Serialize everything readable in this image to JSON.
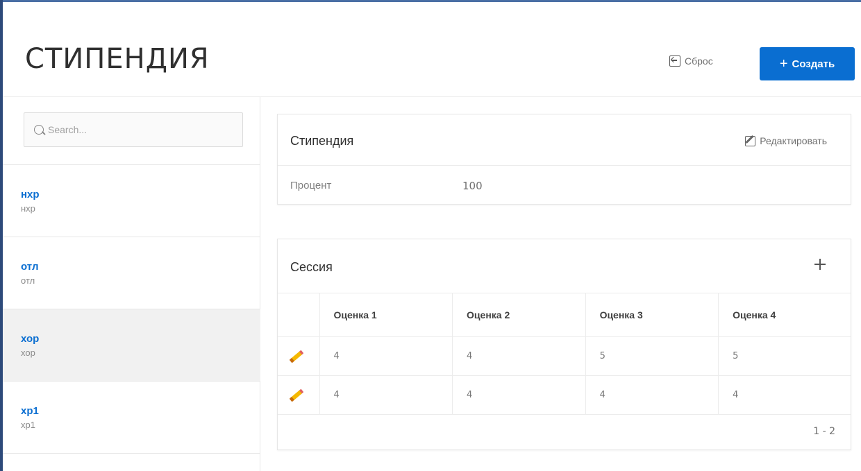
{
  "header": {
    "title": "СТИПЕНДИЯ",
    "reset_label": "Сброс",
    "create_label": "Создать"
  },
  "sidebar": {
    "search_placeholder": "Search...",
    "items": [
      {
        "title": "нхр",
        "subtitle": "нхр",
        "selected": false
      },
      {
        "title": "отл",
        "subtitle": "отл",
        "selected": false
      },
      {
        "title": "хор",
        "subtitle": "хор",
        "selected": true
      },
      {
        "title": "хр1",
        "subtitle": "хр1",
        "selected": false
      }
    ]
  },
  "scholarship_card": {
    "title": "Стипендия",
    "edit_label": "Редактировать",
    "field_label": "Процент",
    "field_value": "100"
  },
  "session_card": {
    "title": "Сессия",
    "columns": [
      "Оценка 1",
      "Оценка 2",
      "Оценка 3",
      "Оценка 4"
    ],
    "rows": [
      [
        "4",
        "4",
        "5",
        "5"
      ],
      [
        "4",
        "4",
        "4",
        "4"
      ]
    ],
    "pagination": "1 - 2"
  },
  "colors": {
    "accent": "#0a6ed1",
    "link": "#0a6ed1",
    "selected_bg": "#f1f1f1"
  },
  "icons": {
    "reset": "reset-icon",
    "create": "plus-icon",
    "search": "search-icon",
    "edit": "edit-icon",
    "add": "plus-icon",
    "row_edit": "pencil-icon"
  }
}
